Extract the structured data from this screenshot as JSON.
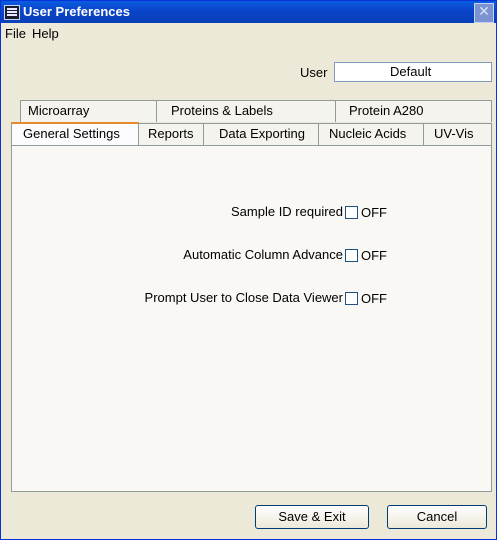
{
  "window": {
    "title": "User Preferences"
  },
  "menu": {
    "items": [
      "File",
      "Help"
    ]
  },
  "user": {
    "label": "User",
    "value": "Default"
  },
  "tabs": {
    "row_back": [
      "Microarray",
      "Proteins & Labels",
      "Protein A280"
    ],
    "row_front": [
      "General Settings",
      "Reports",
      "Data Exporting",
      "Nucleic Acids",
      "UV-Vis"
    ],
    "selected": "General Settings"
  },
  "options": [
    {
      "label": "Sample ID required",
      "checked": false,
      "state": "OFF"
    },
    {
      "label": "Automatic Column Advance",
      "checked": false,
      "state": "OFF"
    },
    {
      "label": "Prompt User to Close Data Viewer",
      "checked": false,
      "state": "OFF"
    }
  ],
  "buttons": {
    "save": "Save & Exit",
    "cancel": "Cancel"
  },
  "colors": {
    "titlebar": "#0a5ce0",
    "active_tab_accent": "#e68b2c",
    "window_bg": "#ece9d8"
  }
}
